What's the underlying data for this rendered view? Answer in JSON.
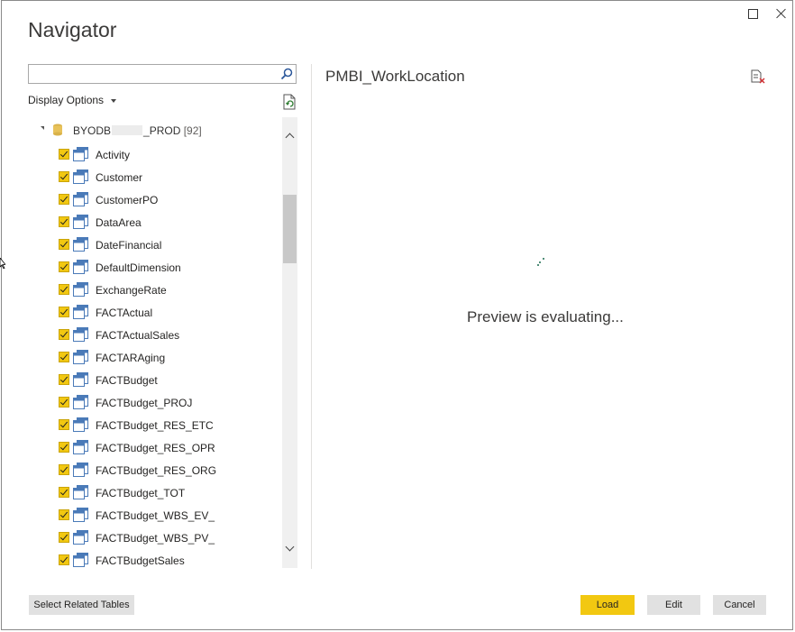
{
  "dialog": {
    "title": "Navigator"
  },
  "search": {
    "value": "",
    "placeholder": ""
  },
  "display_options": {
    "label": "Display Options"
  },
  "tree": {
    "root": {
      "name_prefix": "BYODB",
      "name_suffix": "_PROD",
      "count": "[92]",
      "expanded": true
    },
    "items": [
      {
        "label": "Activity",
        "checked": true
      },
      {
        "label": "Customer",
        "checked": true
      },
      {
        "label": "CustomerPO",
        "checked": true
      },
      {
        "label": "DataArea",
        "checked": true
      },
      {
        "label": "DateFinancial",
        "checked": true
      },
      {
        "label": "DefaultDimension",
        "checked": true
      },
      {
        "label": "ExchangeRate",
        "checked": true
      },
      {
        "label": "FACTActual",
        "checked": true
      },
      {
        "label": "FACTActualSales",
        "checked": true
      },
      {
        "label": "FACTARAging",
        "checked": true
      },
      {
        "label": "FACTBudget",
        "checked": true
      },
      {
        "label": "FACTBudget_PROJ",
        "checked": true
      },
      {
        "label": "FACTBudget_RES_ETC",
        "checked": true
      },
      {
        "label": "FACTBudget_RES_OPR",
        "checked": true
      },
      {
        "label": "FACTBudget_RES_ORG",
        "checked": true
      },
      {
        "label": "FACTBudget_TOT",
        "checked": true
      },
      {
        "label": "FACTBudget_WBS_EV_",
        "checked": true
      },
      {
        "label": "FACTBudget_WBS_PV_",
        "checked": true
      },
      {
        "label": "FACTBudgetSales",
        "checked": true
      }
    ]
  },
  "preview": {
    "title": "PMBI_WorkLocation",
    "status": "Preview is evaluating..."
  },
  "buttons": {
    "select_related": "Select Related Tables",
    "load": "Load",
    "edit": "Edit",
    "cancel": "Cancel"
  },
  "colors": {
    "accent": "#f2c811",
    "button": "#e1e1e1",
    "table_icon": "#4a7ab8",
    "spinner": "#1b6b4e"
  }
}
